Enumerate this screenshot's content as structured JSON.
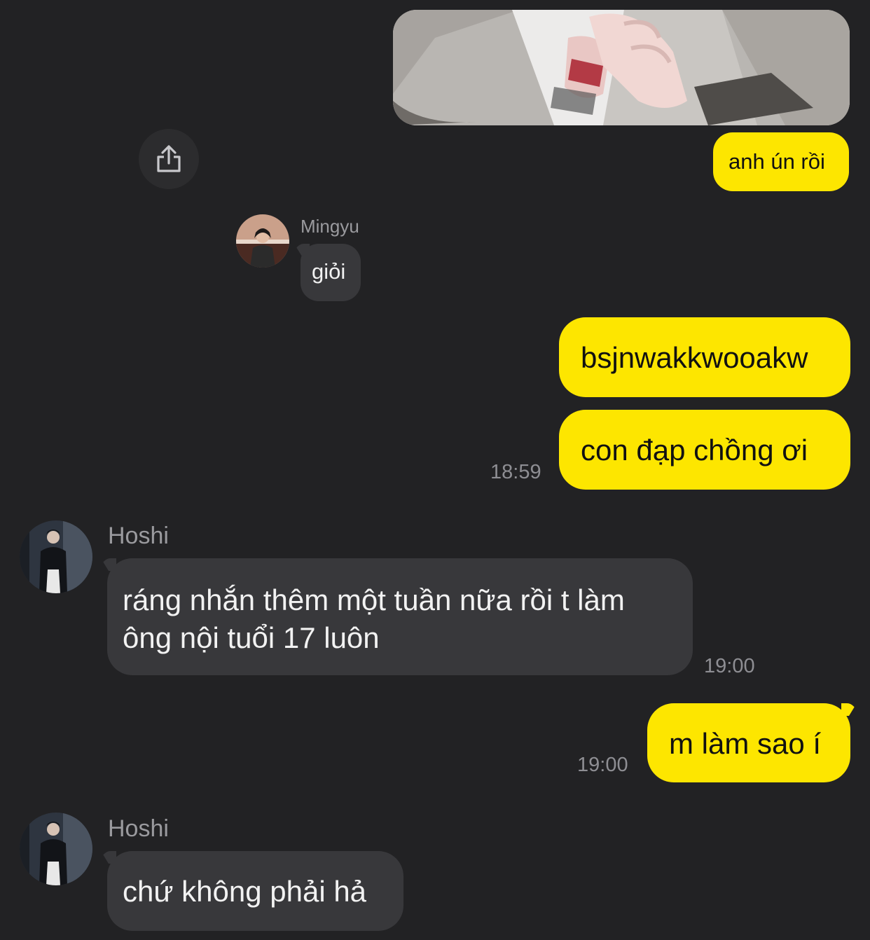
{
  "messages": [
    {
      "id": "m1",
      "from": "me",
      "type": "image"
    },
    {
      "id": "m2",
      "from": "me",
      "text": "anh ún rồi"
    },
    {
      "id": "m3",
      "from": "Mingyu",
      "text": "giỏi"
    },
    {
      "id": "m4",
      "from": "me",
      "text": "bsjnwakkwooakw"
    },
    {
      "id": "m5",
      "from": "me",
      "text": "con đạp chồng ơi",
      "time": "18:59"
    },
    {
      "id": "m6",
      "from": "Hoshi",
      "lines": [
        "ráng nhắn thêm một tuần nữa rồi t làm",
        "ông nội tuổi 17 luôn"
      ],
      "time": "19:00"
    },
    {
      "id": "m7",
      "from": "me",
      "text": "m làm sao í",
      "time": "19:00"
    },
    {
      "id": "m8",
      "from": "Hoshi",
      "text": "chứ không phải hả"
    }
  ],
  "senders": {
    "mingyu": "Mingyu",
    "hoshi": "Hoshi"
  },
  "icons": {
    "share": "share-icon"
  },
  "colors": {
    "background": "#222224",
    "my_bubble": "#fde600",
    "their_bubble": "#38383b",
    "timestamp": "#8e8e93"
  }
}
